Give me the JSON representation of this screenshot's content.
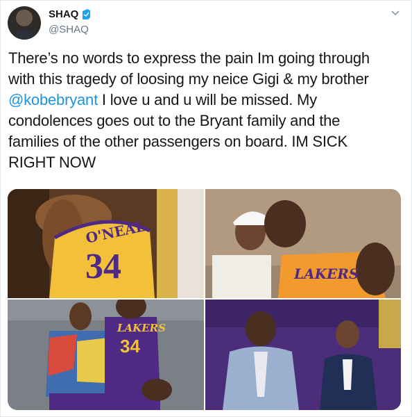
{
  "author": {
    "name": "SHAQ",
    "handle": "@SHAQ"
  },
  "tweet": {
    "line1": "There’s no words to express the pain Im going through",
    "line2": "with this tragedy of loosing my neice Gigi & my brother",
    "mention": "@kobebryant",
    "line3_rest": " I love u and u will be missed. My",
    "line4": "condolences goes out to the Bryant family and the",
    "line5": "families of the other passengers on board. IM SICK",
    "line6": "RIGHT NOW"
  },
  "photos": {
    "p1": {
      "jersey_name": "O'NEAL",
      "jersey_number": "34"
    },
    "p2": {
      "jersey_text": "LAKERS"
    },
    "p3": {
      "jersey_text": "LAKERS",
      "jersey_number": "34"
    }
  },
  "colors": {
    "accent": "#1b95e0",
    "text": "#14171a",
    "secondary": "#657786",
    "lakers_gold": "#f3c03a",
    "lakers_purple": "#4f2a84"
  },
  "icons": {
    "verified": "verified-badge-icon",
    "caret": "chevron-down-icon"
  }
}
